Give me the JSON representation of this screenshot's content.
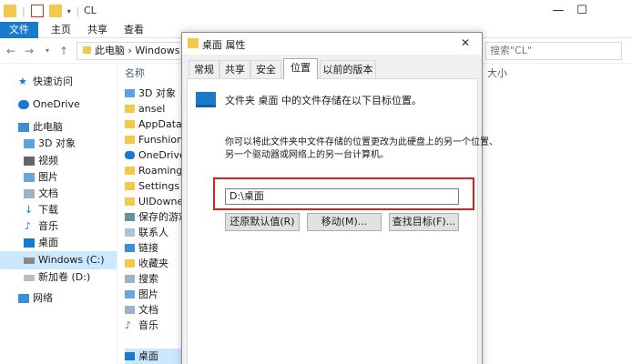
{
  "window": {
    "title": "CL",
    "minimize": "—",
    "maximize": "☐"
  },
  "ribbon": {
    "tabs": [
      "文件",
      "主页",
      "共享",
      "查看"
    ]
  },
  "address": {
    "path_root": "此电脑",
    "path_current": "Windows",
    "search_placeholder": "搜索\"CL\""
  },
  "sidebar": {
    "items": [
      {
        "label": "快速访问",
        "icon": "star-icon"
      },
      {
        "label": "OneDrive",
        "icon": "cloud-icon"
      },
      {
        "label": "此电脑",
        "icon": "computer-icon"
      },
      {
        "label": "3D 对象",
        "icon": "cube-icon"
      },
      {
        "label": "视频",
        "icon": "video-icon"
      },
      {
        "label": "图片",
        "icon": "image-icon"
      },
      {
        "label": "文档",
        "icon": "document-icon"
      },
      {
        "label": "下载",
        "icon": "download-icon"
      },
      {
        "label": "音乐",
        "icon": "music-icon"
      },
      {
        "label": "桌面",
        "icon": "desktop-icon"
      },
      {
        "label": "Windows (C:)",
        "icon": "drive-icon"
      },
      {
        "label": "新加卷 (D:)",
        "icon": "drive-icon"
      },
      {
        "label": "网络",
        "icon": "network-icon"
      }
    ]
  },
  "files": {
    "header_name": "名称",
    "header_size": "大小",
    "items": [
      "3D 对象",
      "ansel",
      "AppData",
      "Funshion",
      "OneDrive",
      "Roaming",
      "Settings",
      "UIDowner",
      "保存的游戏",
      "联系人",
      "链接",
      "收藏夹",
      "搜索",
      "图片",
      "文档",
      "音乐",
      "桌面"
    ]
  },
  "dialog": {
    "title": "桌面 属性",
    "close": "✕",
    "tabs": [
      "常规",
      "共享",
      "安全",
      "位置",
      "以前的版本"
    ],
    "info_text": "文件夹 桌面 中的文件存储在以下目标位置。",
    "desc_line1": "你可以将此文件夹中文件存储的位置更改为此硬盘上的另一个位置、",
    "desc_line2": "另一个驱动器或网络上的另一台计算机。",
    "path_value": "D:\\桌面",
    "btn_restore": "还原默认值(R)",
    "btn_move": "移动(M)...",
    "btn_find": "查找目标(F)..."
  },
  "colors": {
    "accent": "#1979ca",
    "highlight": "#d9211f"
  }
}
